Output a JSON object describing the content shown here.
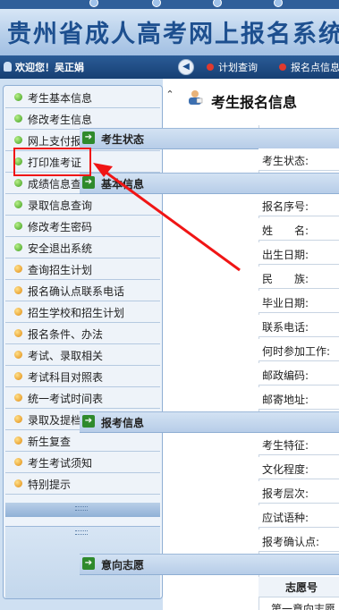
{
  "banner": {
    "title": "贵州省成人高考网上报名系统"
  },
  "nav": {
    "welcome": "欢迎您！吴正娟",
    "links": [
      "计划查询",
      "报名点信息"
    ]
  },
  "sidebar": {
    "items": [
      {
        "label": "考生基本信息",
        "color": "green"
      },
      {
        "label": "修改考生信息",
        "color": "green"
      },
      {
        "label": "网上支付报名费",
        "color": "green"
      },
      {
        "label": "打印准考证",
        "color": "green"
      },
      {
        "label": "成绩信息查询",
        "color": "green"
      },
      {
        "label": "录取信息查询",
        "color": "green"
      },
      {
        "label": "修改考生密码",
        "color": "green"
      },
      {
        "label": "安全退出系统",
        "color": "green"
      },
      {
        "label": "查询招生计划",
        "color": "orange"
      },
      {
        "label": "报名确认点联系电话",
        "color": "orange"
      },
      {
        "label": "招生学校和招生计划",
        "color": "orange"
      },
      {
        "label": "报名条件、办法",
        "color": "orange"
      },
      {
        "label": "考试、录取相关",
        "color": "orange"
      },
      {
        "label": "考试科目对照表",
        "color": "orange"
      },
      {
        "label": "统一考试时间表",
        "color": "orange"
      },
      {
        "label": "录取及提档照顾政策",
        "color": "orange"
      },
      {
        "label": "新生复查",
        "color": "orange"
      },
      {
        "label": "考生考试须知",
        "color": "orange"
      },
      {
        "label": "特别提示",
        "color": "orange"
      }
    ]
  },
  "main": {
    "title": "考生报名信息",
    "sections": {
      "status": {
        "title": "考生状态",
        "rows": [
          "考生状态:"
        ]
      },
      "basic": {
        "title": "基本信息",
        "rows": [
          "报名序号:",
          "姓　　名:",
          "出生日期:",
          "民　　族:",
          "毕业日期:",
          "联系电话:",
          "何时参加工作:",
          "邮政编码:",
          "邮寄地址:"
        ]
      },
      "apply": {
        "title": "报考信息",
        "rows": [
          "考生特征:",
          "文化程度:",
          "报考层次:",
          "应试语种:",
          "报考确认点:"
        ]
      },
      "pref": {
        "title": "意向志愿",
        "col_head": "志愿号",
        "first": "第一意向志愿"
      }
    }
  },
  "colors": {
    "accent": "#1d4f8f",
    "highlight": "#f01515"
  }
}
